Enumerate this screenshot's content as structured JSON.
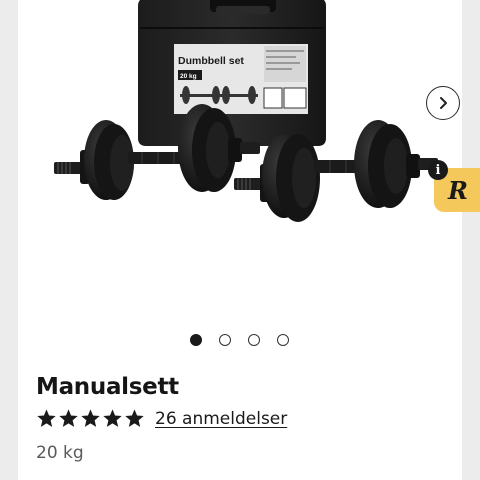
{
  "gallery": {
    "case_label": "Dumbbell set",
    "case_weight": "20 kg",
    "slide_count": 4,
    "active_slide": 0
  },
  "product": {
    "title": "Manualsett",
    "rating": 5,
    "max_rating": 5,
    "reviews_label": "26 anmeldelser",
    "variant": "20 kg"
  },
  "badge": {
    "letter": "R",
    "info": "i",
    "color": "#f5c85c"
  },
  "icons": {
    "next": "chevron-right-icon",
    "info": "info-icon",
    "star": "star-icon"
  }
}
